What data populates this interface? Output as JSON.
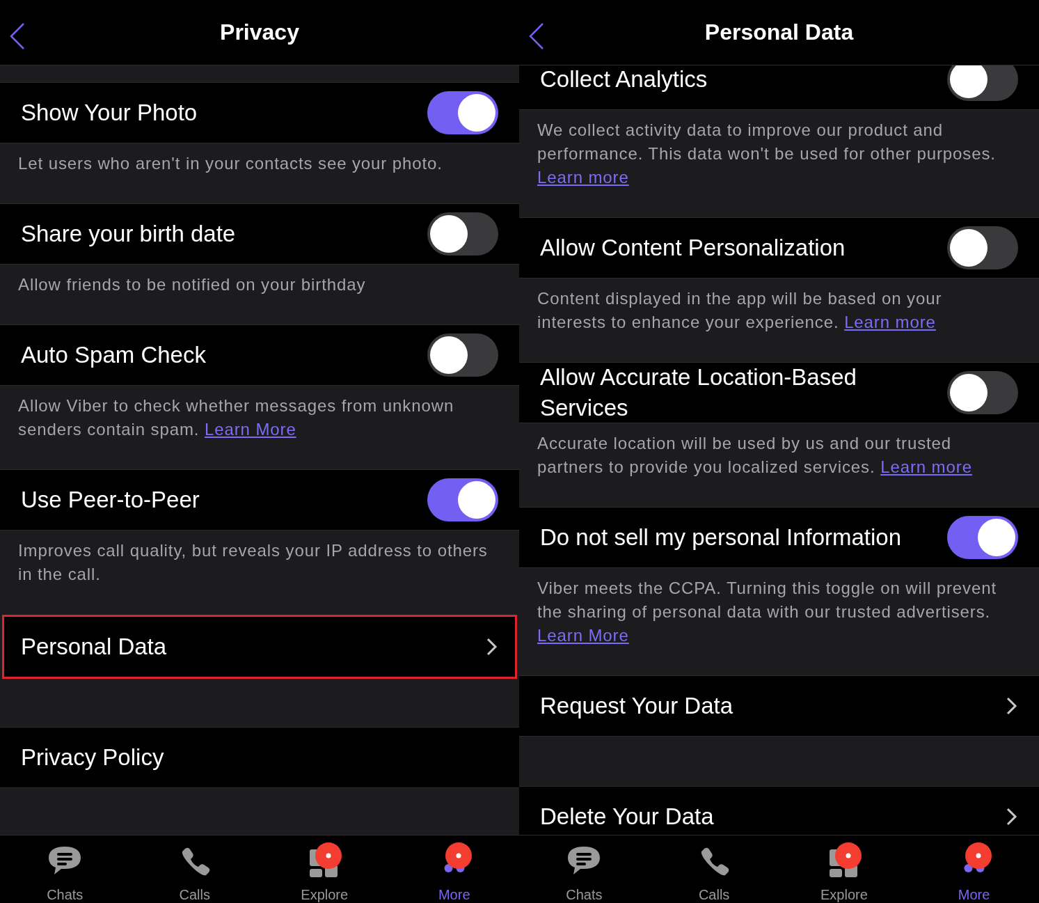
{
  "panes": [
    {
      "title": "Privacy",
      "scrolled": false,
      "groups": [
        {
          "items": [
            {
              "kind": "toggle",
              "title": "Show Your Photo",
              "on": true,
              "description": {
                "text": "Let users who aren't in your contacts see your photo."
              }
            },
            {
              "kind": "toggle",
              "title": "Share your birth date",
              "on": false,
              "description": {
                "text": "Allow friends to be notified on your birthday"
              }
            },
            {
              "kind": "toggle",
              "title": "Auto Spam Check",
              "on": false,
              "description": {
                "text": "Allow Viber to check whether messages from unknown senders contain spam.",
                "link": "Learn More"
              }
            },
            {
              "kind": "toggle",
              "title": "Use Peer-to-Peer",
              "on": true,
              "description": {
                "text": "Improves call quality, but reveals your IP address to others in the call."
              }
            },
            {
              "kind": "nav",
              "title": "Personal Data",
              "highlighted": true
            }
          ]
        },
        {
          "items": [
            {
              "kind": "plain",
              "title": "Privacy Policy"
            }
          ]
        }
      ],
      "tabs": [
        {
          "kind": "chats",
          "label": "Chats",
          "selected": false,
          "badge": false
        },
        {
          "kind": "calls",
          "label": "Calls",
          "selected": false,
          "badge": false
        },
        {
          "kind": "explore",
          "label": "Explore",
          "selected": false,
          "badge": true
        },
        {
          "kind": "more",
          "label": "More",
          "selected": true,
          "badge": true
        }
      ]
    },
    {
      "title": "Personal Data",
      "scrolled": true,
      "groups": [
        {
          "items": [
            {
              "kind": "toggle",
              "title": "Collect Analytics",
              "on": false,
              "description": {
                "text": "We collect activity data to improve our product and performance. This data won't be used for other purposes.",
                "link": "Learn more"
              }
            },
            {
              "kind": "toggle",
              "title": "Allow Content Personalization",
              "on": false,
              "description": {
                "text": "Content displayed in the app will be based on your interests to enhance your experience.",
                "link": "Learn more"
              }
            },
            {
              "kind": "toggle",
              "title": "Allow Accurate Location-Based Services",
              "on": false,
              "description": {
                "text": "Accurate location will be used by us and our trusted partners to provide you localized services.",
                "link": "Learn more"
              }
            },
            {
              "kind": "toggle",
              "title": "Do not sell my personal Information",
              "on": true,
              "description": {
                "text": "Viber meets the CCPA. Turning this toggle on will prevent the sharing of personal data with our trusted advertisers.",
                "link": "Learn More"
              }
            },
            {
              "kind": "nav",
              "title": "Request Your Data",
              "highlighted": false
            }
          ]
        },
        {
          "items": [
            {
              "kind": "nav",
              "title": "Delete Your Data",
              "highlighted": false
            }
          ]
        }
      ],
      "tabs": [
        {
          "kind": "chats",
          "label": "Chats",
          "selected": false,
          "badge": false
        },
        {
          "kind": "calls",
          "label": "Calls",
          "selected": false,
          "badge": false
        },
        {
          "kind": "explore",
          "label": "Explore",
          "selected": false,
          "badge": true
        },
        {
          "kind": "more",
          "label": "More",
          "selected": true,
          "badge": true
        }
      ]
    }
  ]
}
